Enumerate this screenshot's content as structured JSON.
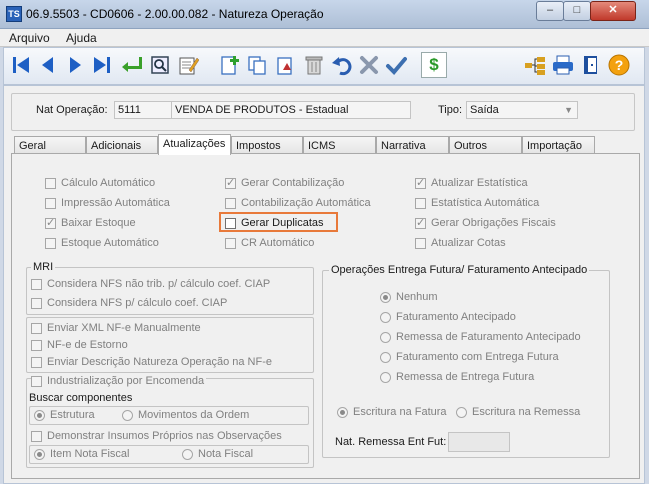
{
  "window": {
    "title": "06.9.5503 - CD0606 - 2.00.00.082 - Natureza Operação",
    "app_icon": "TS"
  },
  "window_buttons": {
    "minimize": "–",
    "maximize": "□",
    "close": "✕"
  },
  "menu": {
    "items": [
      "Arquivo",
      "Ajuda"
    ]
  },
  "toolbar": {
    "icons": [
      "first-record-icon",
      "previous-record-icon",
      "next-record-icon",
      "last-record-icon",
      "confirm-return-icon",
      "preview-icon",
      "edit-document-icon",
      "new-record-icon",
      "copy-record-icon",
      "duplicate-icon",
      "delete-icon",
      "undo-icon",
      "cancel-icon",
      "check-icon",
      "currency-icon",
      "tree-structure-icon",
      "print-icon",
      "exit-icon",
      "help-icon"
    ]
  },
  "header": {
    "nat_operacao_label": "Nat Operação:",
    "nat_operacao_code": "5111",
    "nat_operacao_desc": "VENDA DE PRODUTOS - Estadual",
    "tipo_label": "Tipo:",
    "tipo_value": "Saída"
  },
  "tabs": [
    "Geral",
    "Adicionais",
    "Atualizações",
    "Impostos",
    "ICMS",
    "Narrativa",
    "Outros",
    "Importação"
  ],
  "active_tab": "Atualizações",
  "updates": {
    "col1": [
      {
        "label": "Cálculo Automático",
        "checked": false
      },
      {
        "label": "Impressão Automática",
        "checked": false
      },
      {
        "label": "Baixar Estoque",
        "checked": true
      },
      {
        "label": "Estoque Automático",
        "checked": false
      }
    ],
    "col2": [
      {
        "label": "Gerar Contabilização",
        "checked": true
      },
      {
        "label": "Contabilização Automática",
        "checked": false
      },
      {
        "label": "Gerar Duplicatas",
        "checked": false
      },
      {
        "label": "CR Automático",
        "checked": false
      }
    ],
    "col3": [
      {
        "label": "Atualizar Estatística",
        "checked": true
      },
      {
        "label": "Estatística Automática",
        "checked": false
      },
      {
        "label": "Gerar Obrigações Fiscais",
        "checked": true
      },
      {
        "label": "Atualizar Cotas",
        "checked": false
      }
    ]
  },
  "mri": {
    "title": "MRI",
    "items": [
      "Considera NFS não trib. p/ cálculo coef. CIAP",
      "Considera NFS p/ cálculo coef. CIAP"
    ]
  },
  "nfe": {
    "items": [
      "Enviar XML NF-e Manualmente",
      "NF-e de Estorno",
      "Enviar Descrição Natureza Operação na NF-e"
    ]
  },
  "industrializacao": {
    "label": "Industrialização por Encomenda",
    "buscar_label": "Buscar componentes",
    "estrutura": "Estrutura",
    "movimentos": "Movimentos da Ordem",
    "demonstrar": "Demonstrar Insumos Próprios nas Observações",
    "item_nf": "Item Nota Fiscal",
    "nota_fiscal": "Nota Fiscal"
  },
  "entrega_futura": {
    "title": "Operações Entrega Futura/ Faturamento Antecipado",
    "options": [
      "Nenhum",
      "Faturamento Antecipado",
      "Remessa de Faturamento Antecipado",
      "Faturamento com Entrega Futura",
      "Remessa de Entrega Futura"
    ],
    "selected": "Nenhum",
    "escritura_fatura": "Escritura na Fatura",
    "escritura_remessa": "Escritura na Remessa",
    "nat_remessa_label": "Nat. Remessa Ent Fut:",
    "nat_remessa_value": ""
  },
  "colors": {
    "highlight": "#e8793a",
    "titlebar": "#b9c9df"
  }
}
